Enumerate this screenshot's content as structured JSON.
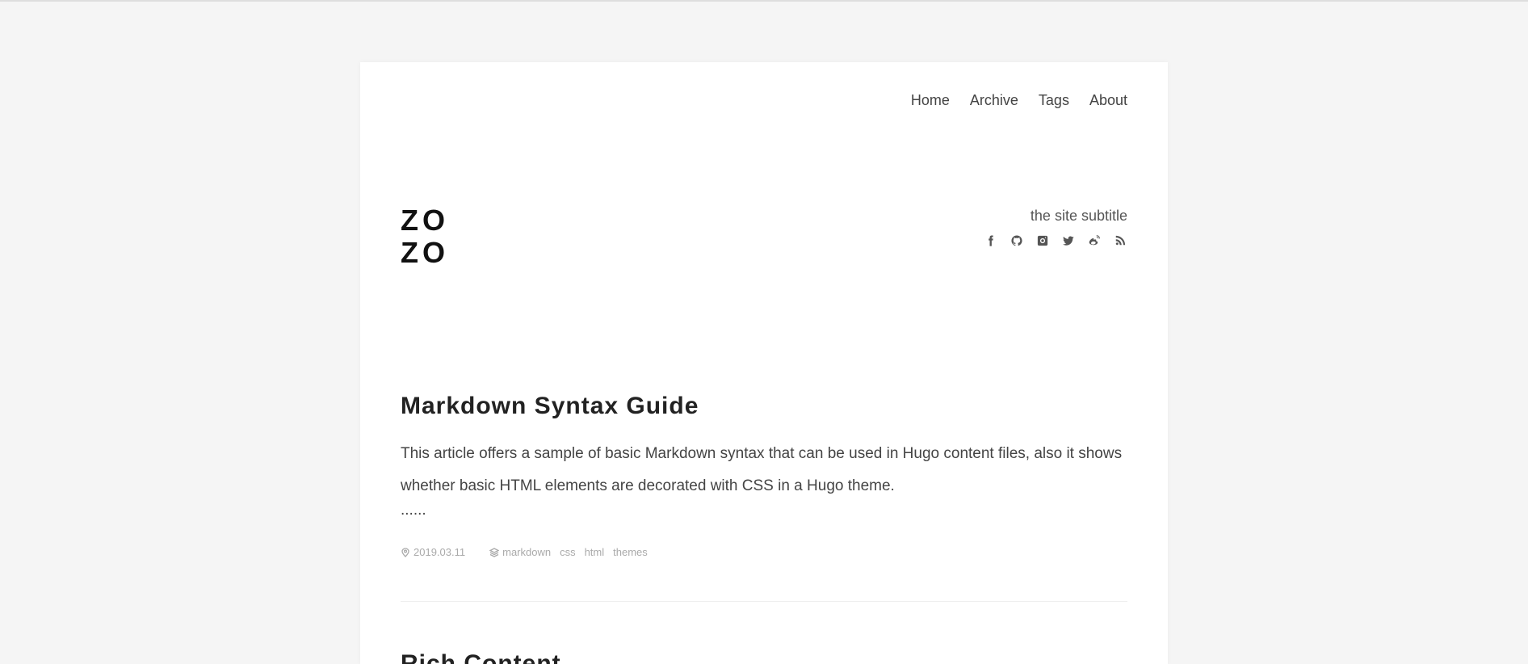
{
  "nav": {
    "items": [
      "Home",
      "Archive",
      "Tags",
      "About"
    ]
  },
  "site": {
    "logo_line1": "ZO",
    "logo_line2": "ZO",
    "subtitle": "the site subtitle",
    "social_icons": [
      "facebook-icon",
      "github-icon",
      "instagram-icon",
      "twitter-icon",
      "weibo-icon",
      "rss-icon"
    ]
  },
  "posts": [
    {
      "title": "Markdown Syntax Guide",
      "summary": "This article offers a sample of basic Markdown syntax that can be used in Hugo content files, also it shows whether basic HTML elements are decorated with CSS in a Hugo theme.",
      "more": "......",
      "date": "2019.03.11",
      "tags": [
        "markdown",
        "css",
        "html",
        "themes"
      ]
    },
    {
      "title": "Rich Content"
    }
  ],
  "colors": {
    "page_bg": "#f5f5f5",
    "card_bg": "#ffffff",
    "text": "#444444",
    "meta": "#aaaaaa"
  }
}
